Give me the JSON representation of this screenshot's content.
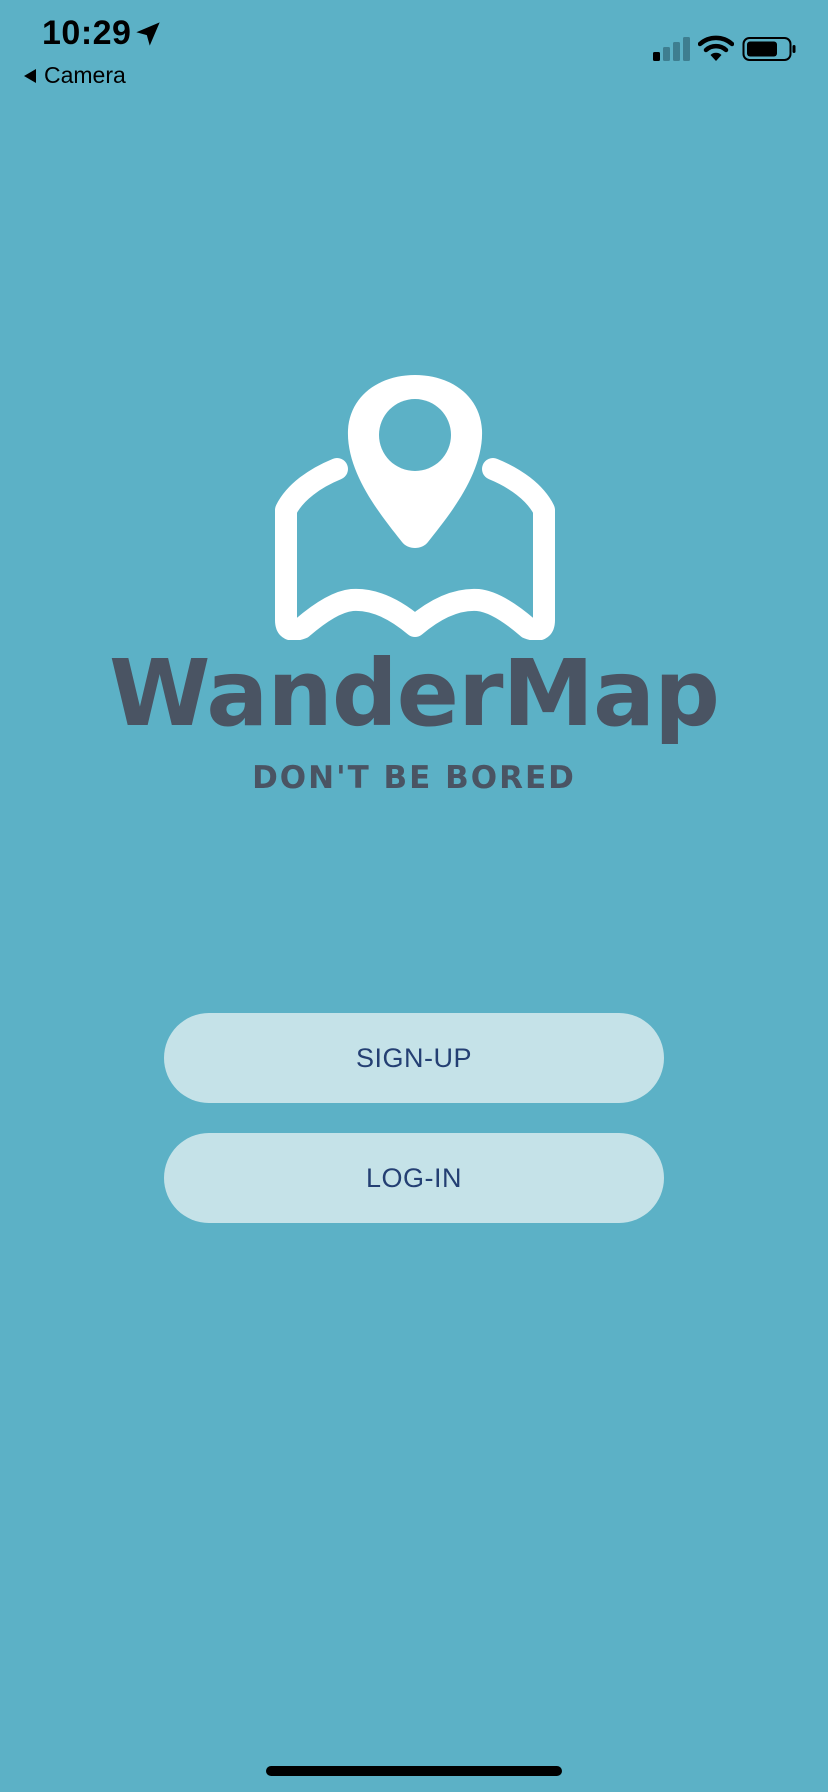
{
  "status_bar": {
    "time": "10:29",
    "back_label": "Camera",
    "location_icon": "location-arrow-icon",
    "signal_icon": "cellular-signal-icon",
    "wifi_icon": "wifi-icon",
    "battery_icon": "battery-icon"
  },
  "brand": {
    "logo_icon": "map-pin-logo-icon",
    "name": "WanderMap",
    "tagline": "DON'T BE BORED"
  },
  "actions": {
    "signup_label": "SIGN-UP",
    "login_label": "LOG-IN"
  },
  "colors": {
    "background": "#5CB1C6",
    "button_bg": "#C5E2E8",
    "button_text": "#243F73",
    "brand_text": "#4A5463",
    "logo": "#FFFFFF"
  }
}
